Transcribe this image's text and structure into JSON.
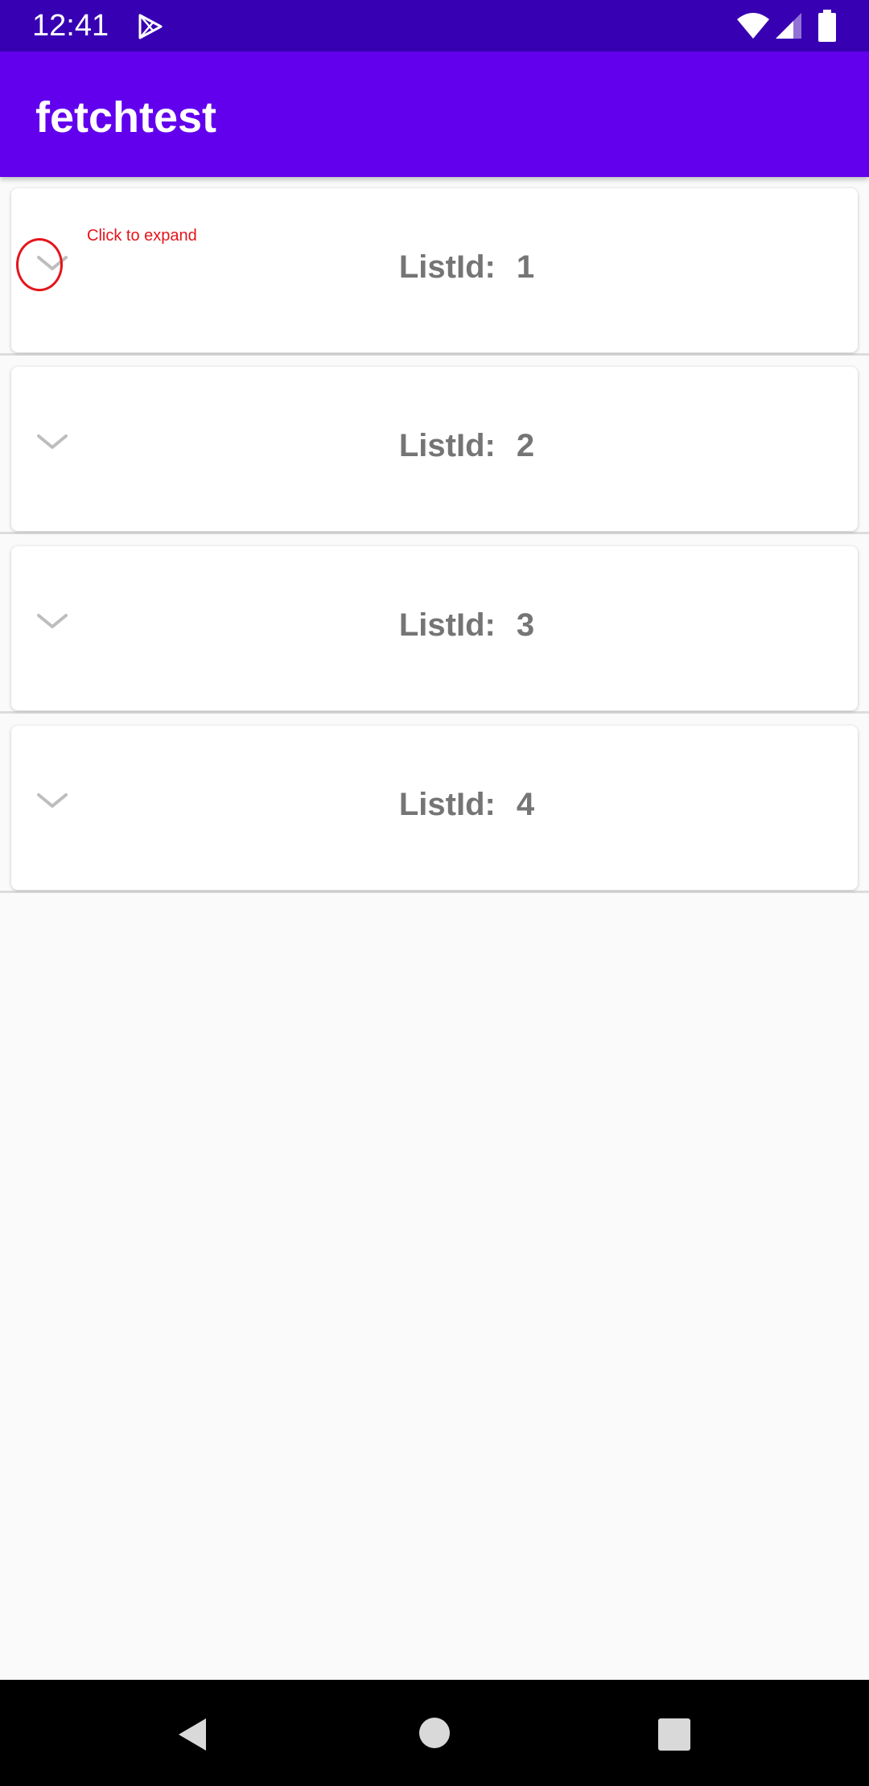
{
  "status_bar": {
    "time": "12:41",
    "icons": [
      "play-store-icon",
      "wifi-icon",
      "cell-signal-icon",
      "battery-icon"
    ]
  },
  "app_bar": {
    "title": "fetchtest",
    "color": "#6200ee"
  },
  "list": {
    "items": [
      {
        "label": "ListId:",
        "value": "1",
        "expanded": false
      },
      {
        "label": "ListId:",
        "value": "2",
        "expanded": false
      },
      {
        "label": "ListId:",
        "value": "3",
        "expanded": false
      },
      {
        "label": "ListId:",
        "value": "4",
        "expanded": false
      }
    ]
  },
  "annotation": {
    "text": "Click to expand",
    "color": "#e4141b"
  },
  "nav_bar": {
    "icons": [
      "back-icon",
      "home-icon",
      "recents-icon"
    ]
  }
}
